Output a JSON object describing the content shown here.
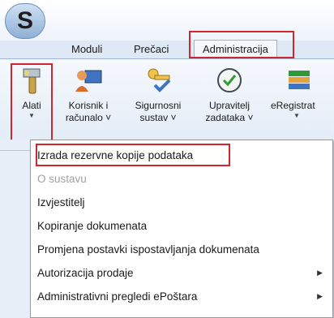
{
  "app": {
    "logo_letter": "S"
  },
  "tabs": [
    {
      "label": "Moduli"
    },
    {
      "label": "Prečaci"
    },
    {
      "label": "Administracija"
    }
  ],
  "ribbon": {
    "buttons": [
      {
        "line1": "Alati",
        "line2": "",
        "icon": "tools-icon"
      },
      {
        "line1": "Korisnik i",
        "line2": "računalo",
        "icon": "user-computer-icon"
      },
      {
        "line1": "Sigurnosni",
        "line2": "sustav",
        "icon": "security-keys-icon"
      },
      {
        "line1": "Upravitelj",
        "line2": "zadataka",
        "icon": "task-clock-icon"
      },
      {
        "line1": "eRegistrat",
        "line2": "",
        "icon": "books-icon"
      }
    ]
  },
  "menu": {
    "items": [
      {
        "label": "Izrada rezervne kopije podataka"
      },
      {
        "label": "O sustavu"
      },
      {
        "label": "Izvjestitelj"
      },
      {
        "label": "Kopiranje dokumenata"
      },
      {
        "label": "Promjena postavki ispostavljanja dokumenata"
      },
      {
        "label": "Autorizacija prodaje"
      },
      {
        "label": "Administrativni pregledi ePoštara"
      }
    ]
  },
  "colors": {
    "highlight": "#d0262d",
    "ribbon": "#e3ecf7"
  }
}
